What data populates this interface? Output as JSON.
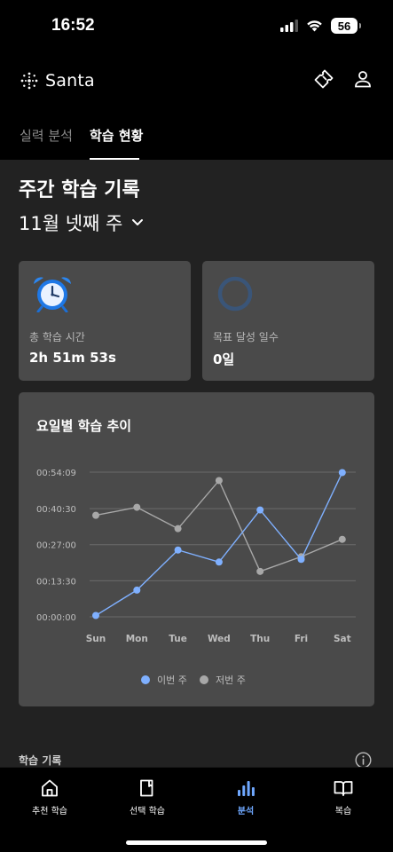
{
  "status_bar": {
    "time": "16:52",
    "battery": "56",
    "icons": [
      "signal-icon",
      "wifi-icon",
      "battery-icon"
    ]
  },
  "header": {
    "logo_text": "Santa",
    "icons": [
      "ticket-icon",
      "profile-icon"
    ]
  },
  "tabs": [
    {
      "label": "실력 분석",
      "active": false
    },
    {
      "label": "학습 현황",
      "active": true
    }
  ],
  "weekly": {
    "title": "주간 학습 기록",
    "week_label": "11월 넷째 주"
  },
  "cards": {
    "study_time": {
      "label": "총 학습 시간",
      "value": "2h 51m 53s",
      "icon": "alarm-clock-icon"
    },
    "goal_days": {
      "label": "목표 달성 일수",
      "value": "0일",
      "icon": "progress-ring-icon"
    }
  },
  "chart_card": {
    "title": "요일별 학습 추이"
  },
  "chart_data": {
    "type": "line",
    "categories": [
      "Sun",
      "Mon",
      "Tue",
      "Wed",
      "Thu",
      "Fri",
      "Sat"
    ],
    "y_tick_labels": [
      "00:00:00",
      "00:13:30",
      "00:27:00",
      "00:40:30",
      "00:54:09"
    ],
    "y_tick_values_minutes": [
      0,
      13.5,
      27,
      40.5,
      54.15
    ],
    "ylim_minutes": [
      0,
      54.15
    ],
    "series": [
      {
        "name": "이번 주",
        "color": "#7fb0ff",
        "values_minutes": [
          0.5,
          10,
          25,
          20.5,
          40,
          21.5,
          54
        ]
      },
      {
        "name": "저번 주",
        "color": "#a8a8a8",
        "values_minutes": [
          38,
          41,
          33,
          51,
          17,
          22.5,
          29
        ]
      }
    ],
    "grid": true,
    "legend_position": "bottom-center"
  },
  "records": {
    "title": "학습 기록",
    "info_icon": "info-icon"
  },
  "bottom_nav": [
    {
      "label": "추천 학습",
      "icon": "home-icon",
      "active": false
    },
    {
      "label": "선택 학습",
      "icon": "book-page-icon",
      "active": false
    },
    {
      "label": "분석",
      "icon": "bar-chart-icon",
      "active": true
    },
    {
      "label": "복습",
      "icon": "open-book-icon",
      "active": false
    }
  ],
  "colors": {
    "accent": "#6fa8ff",
    "background": "#000000",
    "content_bg": "#222222",
    "card_bg": "#4a4a4a"
  }
}
